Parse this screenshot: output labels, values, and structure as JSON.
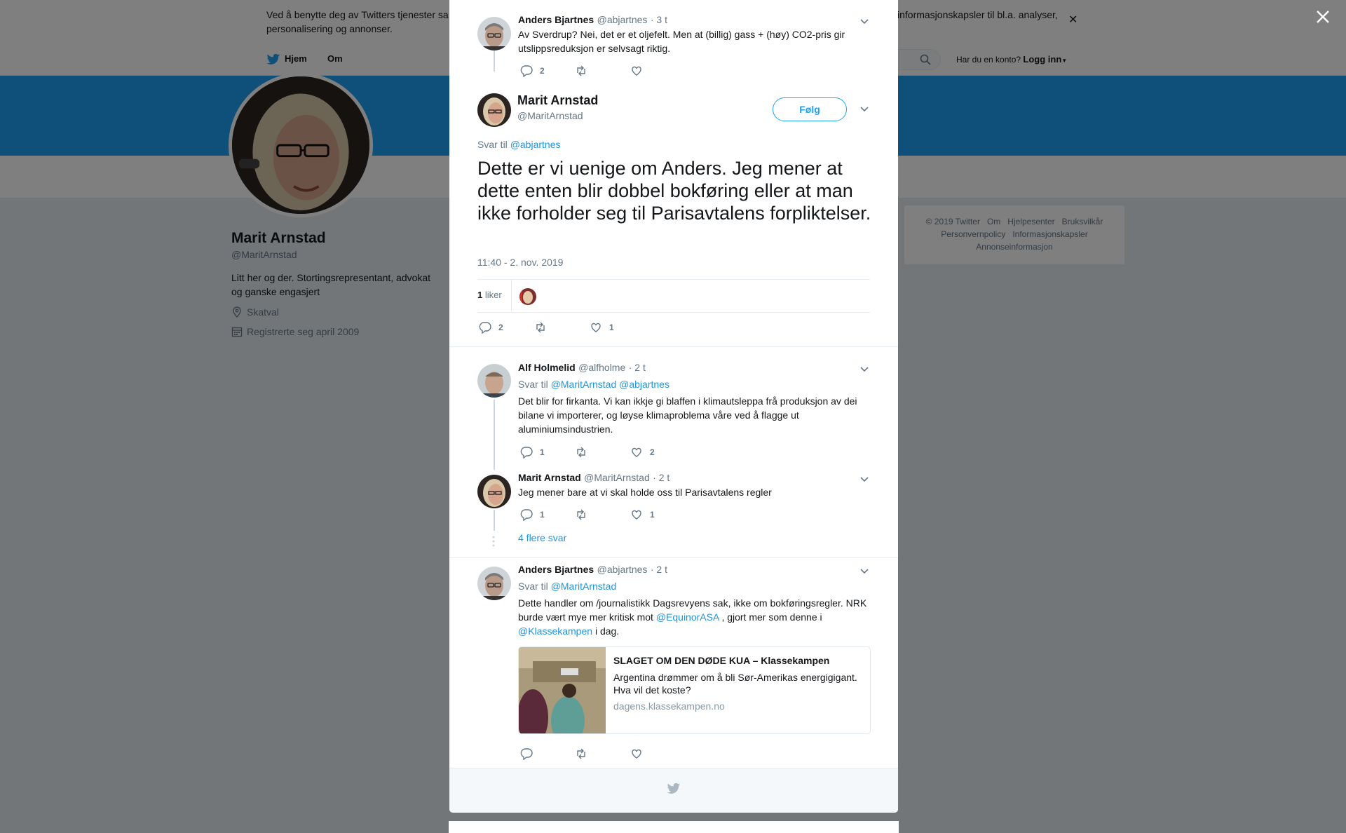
{
  "cookie": {
    "text": "Ved å benytte deg av Twitters tjenester sa",
    "text_right": "informasjonskapsler til bl.a. analyser,",
    "text_line2": "personalisering og annonser."
  },
  "nav": {
    "home": "Hjem",
    "about": "Om",
    "account_question": "Har du en konto?",
    "login": "Logg inn"
  },
  "profile": {
    "name": "Marit Arnstad",
    "handle": "@MaritArnstad",
    "bio": "Litt her og der. Stortingsrepresentant, advokat og ganske engasjert",
    "location": "Skatval",
    "joined": "Registrerte seg april 2009"
  },
  "footer": {
    "links_row1": [
      "© 2019 Twitter",
      "Om",
      "Hjelpesenter",
      "Bruksvilkår"
    ],
    "links_row2": [
      "Personvernpolicy",
      "Informasjonskapsler"
    ],
    "links_row3": [
      "Annonseinformasjon"
    ]
  },
  "parent_tweet": {
    "name": "Anders Bjartnes",
    "handle": "@abjartnes",
    "time": "· 3 t",
    "text_line1": "Av Sverdrup? Nei, det er et oljefelt. Men at (billig) gass + (høy) CO2-pris gir",
    "text_line2": "utslippsreduksjon er selvsagt riktig.",
    "replies": "2"
  },
  "main_tweet": {
    "name": "Marit Arnstad",
    "handle": "@MaritArnstad",
    "follow": "Følg",
    "reply_prefix": "Svar til",
    "reply_to": "@abjartnes",
    "text": "Dette er vi uenige om Anders. Jeg mener at dette enten blir dobbel bokføring eller at man ikke forholder seg til Parisavtalens forpliktelser.",
    "timestamp": "11:40 - 2. nov. 2019",
    "likes_count": "1",
    "likes_label": "liker",
    "replies": "2",
    "like_count_action": "1"
  },
  "replies": [
    {
      "name": "Alf Holmelid",
      "handle": "@alfholme",
      "time": "· 2 t",
      "reply_prefix": "Svar til",
      "reply_to": "@MaritArnstad @abjartnes",
      "text": "Det blir for firkanta. Vi kan ikkje gi blaffen i klimautsleppa frå produksjon av dei bilane vi importerer, og løyse klimaproblema våre ved å flagge ut aluminiumsindustrien.",
      "replies": "1",
      "likes": "2"
    },
    {
      "name": "Marit Arnstad",
      "handle": "@MaritArnstad",
      "time": "· 2 t",
      "text": "Jeg mener bare at vi skal holde oss til Parisavtalens regler",
      "replies": "1",
      "likes": "1"
    },
    {
      "name": "Anders Bjartnes",
      "handle": "@abjartnes",
      "time": "· 2 t",
      "reply_prefix": "Svar til",
      "reply_to": "@MaritArnstad",
      "text_a": "Dette handler om /journalistikk Dagsrevyens sak, ikke om bokføringsregler. NRK burde vært mye mer kritisk mot",
      "mention1": "@EquinorASA",
      "text_b": ", gjort mer som denne i",
      "mention2": "@Klassekampen",
      "text_c": "i dag."
    }
  ],
  "more_replies": "4 flere svar",
  "card": {
    "title": "SLAGET OM DEN DØDE KUA – Klassekampen",
    "description": "Argentina drømmer om å bli Sør-Amerikas energigigant. Hva vil det koste?",
    "domain": "dagens.klassekampen.no"
  },
  "colors": {
    "accent": "#1da1f2",
    "link": "#1b95e0",
    "muted": "#657786",
    "overlay": "rgba(0,0,0,0.5)"
  }
}
